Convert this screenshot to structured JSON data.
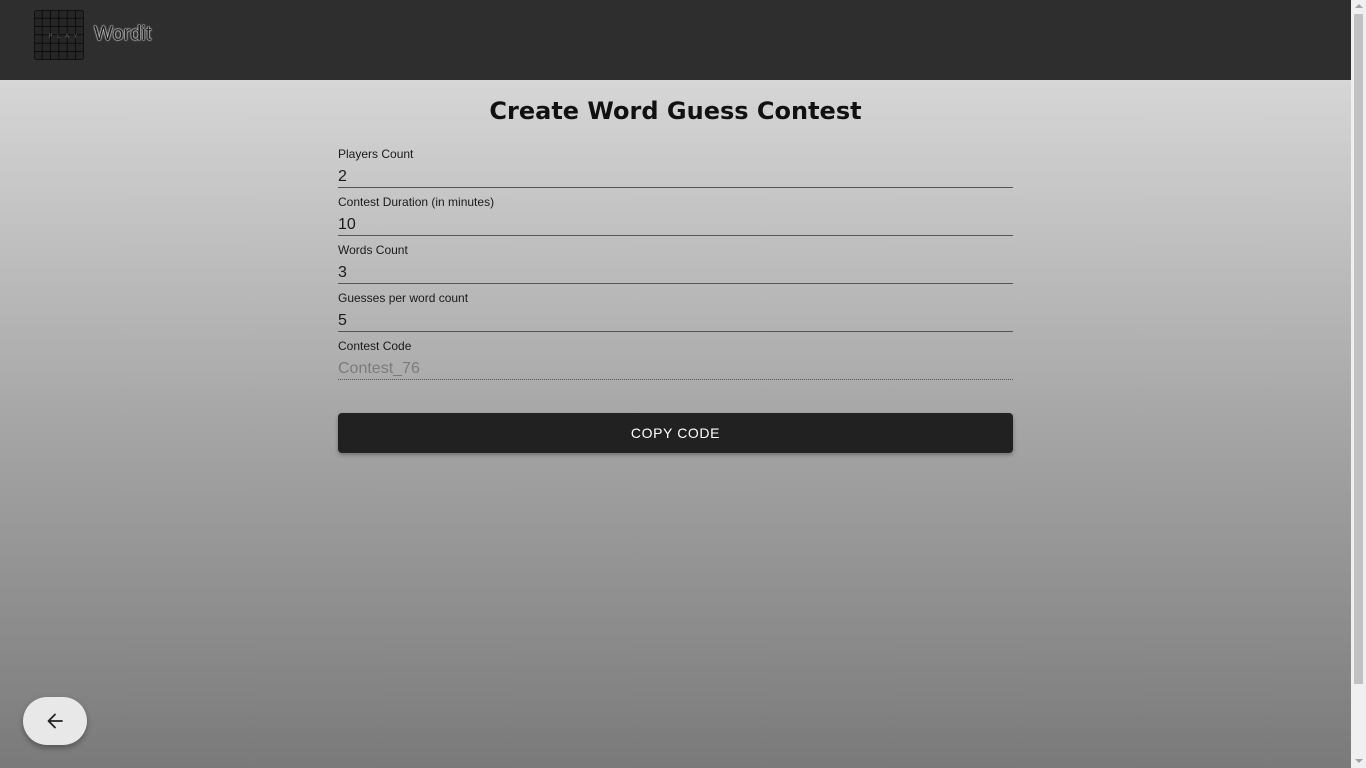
{
  "app": {
    "name": "Wordit",
    "logo_icon": "word-grid-logo-icon",
    "logo_letters": [
      "P",
      "L",
      "A",
      "Y"
    ]
  },
  "page": {
    "title": "Create Word Guess Contest"
  },
  "form": {
    "fields": [
      {
        "label": "Players Count",
        "value": "2"
      },
      {
        "label": "Contest Duration (in minutes)",
        "value": "10"
      },
      {
        "label": "Words Count",
        "value": "3"
      },
      {
        "label": "Guesses per word count",
        "value": "5"
      },
      {
        "label": "Contest Code",
        "value": "Contest_76",
        "disabled": true
      }
    ],
    "copy_button_label": "COPY CODE"
  },
  "fab": {
    "icon": "arrow-left-icon"
  },
  "colors": {
    "appbar": "#2e2e2e",
    "button": "#212121",
    "fab": "#e8e8e8"
  }
}
